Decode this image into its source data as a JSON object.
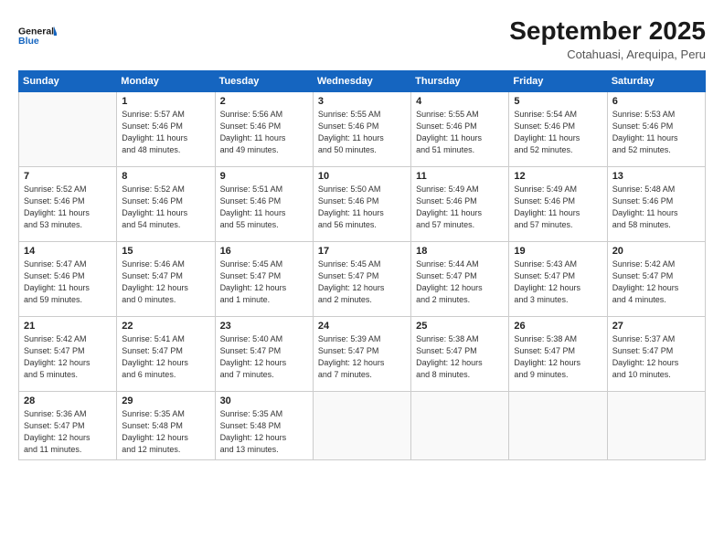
{
  "logo": {
    "line1": "General",
    "line2": "Blue"
  },
  "title": "September 2025",
  "location": "Cotahuasi, Arequipa, Peru",
  "header_days": [
    "Sunday",
    "Monday",
    "Tuesday",
    "Wednesday",
    "Thursday",
    "Friday",
    "Saturday"
  ],
  "weeks": [
    [
      {
        "day": "",
        "info": ""
      },
      {
        "day": "1",
        "info": "Sunrise: 5:57 AM\nSunset: 5:46 PM\nDaylight: 11 hours\nand 48 minutes."
      },
      {
        "day": "2",
        "info": "Sunrise: 5:56 AM\nSunset: 5:46 PM\nDaylight: 11 hours\nand 49 minutes."
      },
      {
        "day": "3",
        "info": "Sunrise: 5:55 AM\nSunset: 5:46 PM\nDaylight: 11 hours\nand 50 minutes."
      },
      {
        "day": "4",
        "info": "Sunrise: 5:55 AM\nSunset: 5:46 PM\nDaylight: 11 hours\nand 51 minutes."
      },
      {
        "day": "5",
        "info": "Sunrise: 5:54 AM\nSunset: 5:46 PM\nDaylight: 11 hours\nand 52 minutes."
      },
      {
        "day": "6",
        "info": "Sunrise: 5:53 AM\nSunset: 5:46 PM\nDaylight: 11 hours\nand 52 minutes."
      }
    ],
    [
      {
        "day": "7",
        "info": "Sunrise: 5:52 AM\nSunset: 5:46 PM\nDaylight: 11 hours\nand 53 minutes."
      },
      {
        "day": "8",
        "info": "Sunrise: 5:52 AM\nSunset: 5:46 PM\nDaylight: 11 hours\nand 54 minutes."
      },
      {
        "day": "9",
        "info": "Sunrise: 5:51 AM\nSunset: 5:46 PM\nDaylight: 11 hours\nand 55 minutes."
      },
      {
        "day": "10",
        "info": "Sunrise: 5:50 AM\nSunset: 5:46 PM\nDaylight: 11 hours\nand 56 minutes."
      },
      {
        "day": "11",
        "info": "Sunrise: 5:49 AM\nSunset: 5:46 PM\nDaylight: 11 hours\nand 57 minutes."
      },
      {
        "day": "12",
        "info": "Sunrise: 5:49 AM\nSunset: 5:46 PM\nDaylight: 11 hours\nand 57 minutes."
      },
      {
        "day": "13",
        "info": "Sunrise: 5:48 AM\nSunset: 5:46 PM\nDaylight: 11 hours\nand 58 minutes."
      }
    ],
    [
      {
        "day": "14",
        "info": "Sunrise: 5:47 AM\nSunset: 5:46 PM\nDaylight: 11 hours\nand 59 minutes."
      },
      {
        "day": "15",
        "info": "Sunrise: 5:46 AM\nSunset: 5:47 PM\nDaylight: 12 hours\nand 0 minutes."
      },
      {
        "day": "16",
        "info": "Sunrise: 5:45 AM\nSunset: 5:47 PM\nDaylight: 12 hours\nand 1 minute."
      },
      {
        "day": "17",
        "info": "Sunrise: 5:45 AM\nSunset: 5:47 PM\nDaylight: 12 hours\nand 2 minutes."
      },
      {
        "day": "18",
        "info": "Sunrise: 5:44 AM\nSunset: 5:47 PM\nDaylight: 12 hours\nand 2 minutes."
      },
      {
        "day": "19",
        "info": "Sunrise: 5:43 AM\nSunset: 5:47 PM\nDaylight: 12 hours\nand 3 minutes."
      },
      {
        "day": "20",
        "info": "Sunrise: 5:42 AM\nSunset: 5:47 PM\nDaylight: 12 hours\nand 4 minutes."
      }
    ],
    [
      {
        "day": "21",
        "info": "Sunrise: 5:42 AM\nSunset: 5:47 PM\nDaylight: 12 hours\nand 5 minutes."
      },
      {
        "day": "22",
        "info": "Sunrise: 5:41 AM\nSunset: 5:47 PM\nDaylight: 12 hours\nand 6 minutes."
      },
      {
        "day": "23",
        "info": "Sunrise: 5:40 AM\nSunset: 5:47 PM\nDaylight: 12 hours\nand 7 minutes."
      },
      {
        "day": "24",
        "info": "Sunrise: 5:39 AM\nSunset: 5:47 PM\nDaylight: 12 hours\nand 7 minutes."
      },
      {
        "day": "25",
        "info": "Sunrise: 5:38 AM\nSunset: 5:47 PM\nDaylight: 12 hours\nand 8 minutes."
      },
      {
        "day": "26",
        "info": "Sunrise: 5:38 AM\nSunset: 5:47 PM\nDaylight: 12 hours\nand 9 minutes."
      },
      {
        "day": "27",
        "info": "Sunrise: 5:37 AM\nSunset: 5:47 PM\nDaylight: 12 hours\nand 10 minutes."
      }
    ],
    [
      {
        "day": "28",
        "info": "Sunrise: 5:36 AM\nSunset: 5:47 PM\nDaylight: 12 hours\nand 11 minutes."
      },
      {
        "day": "29",
        "info": "Sunrise: 5:35 AM\nSunset: 5:48 PM\nDaylight: 12 hours\nand 12 minutes."
      },
      {
        "day": "30",
        "info": "Sunrise: 5:35 AM\nSunset: 5:48 PM\nDaylight: 12 hours\nand 13 minutes."
      },
      {
        "day": "",
        "info": ""
      },
      {
        "day": "",
        "info": ""
      },
      {
        "day": "",
        "info": ""
      },
      {
        "day": "",
        "info": ""
      }
    ]
  ]
}
